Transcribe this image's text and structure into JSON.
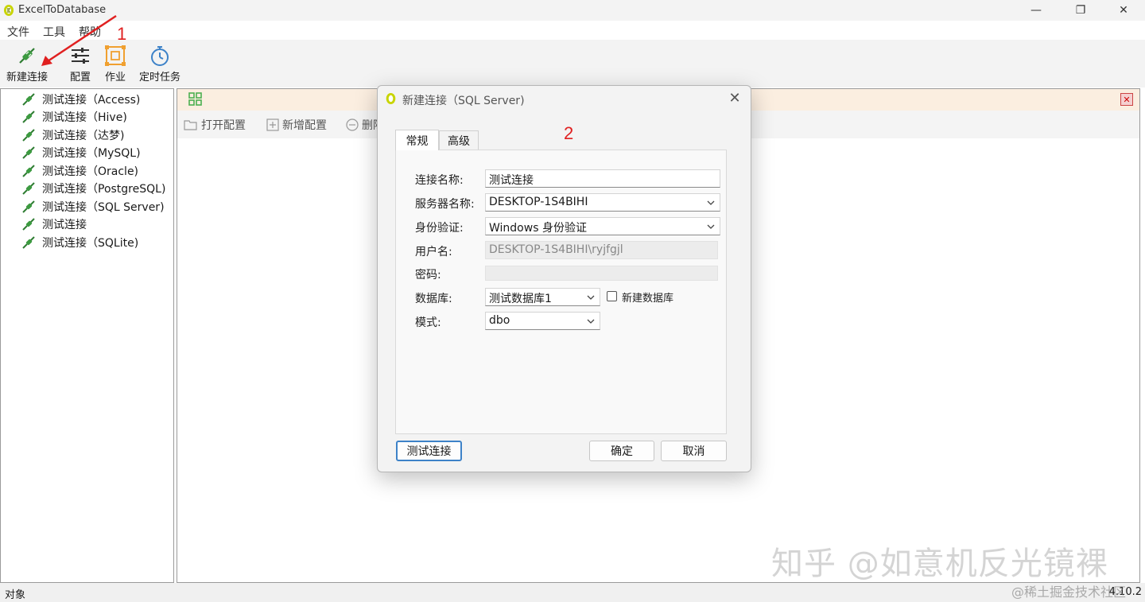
{
  "app": {
    "title": "ExcelToDatabase",
    "version": "4.10.2"
  },
  "window_controls": {
    "minimize": "—",
    "restore": "❐",
    "close": "✕"
  },
  "menu": {
    "items": [
      "文件",
      "工具",
      "帮助"
    ]
  },
  "toolbar": {
    "new_connection": "新建连接",
    "config": "配置",
    "job": "作业",
    "scheduled_task": "定时任务"
  },
  "annotations": {
    "step1": "1",
    "step2": "2"
  },
  "tree": {
    "items": [
      "测试连接（Access)",
      "测试连接（Hive)",
      "测试连接（达梦)",
      "测试连接（MySQL)",
      "测试连接（Oracle)",
      "测试连接（PostgreSQL)",
      "测试连接（SQL Server)",
      "测试连接",
      "测试连接（SQLite)"
    ]
  },
  "config_panel": {
    "open_config": "打开配置",
    "add_config": "新增配置",
    "delete": "删除",
    "close_glyph": "✕"
  },
  "statusbar": {
    "left": "对象",
    "right": "4.10.2"
  },
  "watermark": {
    "text": "知乎 @如意机反光镜裸",
    "source": "@稀土掘金技术社区"
  },
  "dialog": {
    "title": "新建连接（SQL Server)",
    "close_glyph": "✕",
    "tabs": [
      "常规",
      "高级"
    ],
    "fields": {
      "connection_name": {
        "label": "连接名称:",
        "value": "测试连接"
      },
      "server_name": {
        "label": "服务器名称:",
        "value": "DESKTOP-1S4BIHI"
      },
      "auth": {
        "label": "身份验证:",
        "value": "Windows 身份验证"
      },
      "username": {
        "label": "用户名:",
        "value": "DESKTOP-1S4BIHI\\ryjfgjl"
      },
      "password": {
        "label": "密码:",
        "value": ""
      },
      "database": {
        "label": "数据库:",
        "value": "测试数据库1"
      },
      "new_database": {
        "label": "新建数据库",
        "checked": false
      },
      "schema": {
        "label": "模式:",
        "value": "dbo"
      }
    },
    "buttons": {
      "test": "测试连接",
      "ok": "确定",
      "cancel": "取消"
    }
  },
  "colors": {
    "accent": "#3d82c8",
    "annotation": "#e02020",
    "connection_icon": "#2e7d32",
    "config_icon": "#f0a030",
    "timer_icon": "#3d82c8",
    "header_tint": "#fbeee0"
  }
}
